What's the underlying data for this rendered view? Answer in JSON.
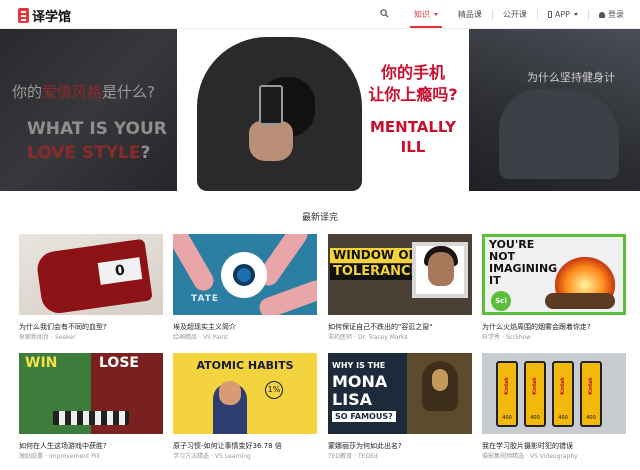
{
  "header": {
    "logo_text": "译学馆",
    "nav": [
      {
        "label": "知识",
        "active": true,
        "dropdown": true
      },
      {
        "label": "精品课",
        "active": false
      },
      {
        "label": "公开课",
        "active": false
      },
      {
        "label": "APP",
        "active": false,
        "dropdown": true
      },
      {
        "label": "登录",
        "active": false
      }
    ]
  },
  "banner": {
    "left_q_prefix": "你的",
    "left_q_hidden": "爱情风格",
    "left_q_suffix": "是什么?",
    "left_en_line1": "WHAT IS YOUR",
    "left_en_red": "LOVE STYLE",
    "left_en_end": "?",
    "center_cn_line1": "你的手机",
    "center_cn_line2": "让你上瘾吗?",
    "center_en_line1": "MENTALLY",
    "center_en_line2": "ILL",
    "right_q": "为什么坚持健身计"
  },
  "section": {
    "title": "最新译完"
  },
  "cards": [
    {
      "title": "为什么我们会有不同的血型?",
      "channel": "探索新闻台",
      "author": "Seeker",
      "thumb_text": "0"
    },
    {
      "title": "埃及超现实主义简介",
      "channel": "绘画精品",
      "author": "VS Paint",
      "thumb_text": "TATE"
    },
    {
      "title": "如何保证自己不跌出的\"容忍之窗\"",
      "channel": "零药医师",
      "author": "Dr. Tracey Marks",
      "thumb_text_1": "WINDOW OF",
      "thumb_text_2": "TOLERANCE"
    },
    {
      "title": "为什么火焰周围的烟雾会跟着你走?",
      "channel": "科学秀",
      "author": "SciShow",
      "thumb_text": "YOU'RE NOT IMAGINING IT",
      "thumb_logo": "Sci"
    },
    {
      "title": "如何在人生这场游戏中获胜?",
      "channel": "激励胶囊",
      "author": "Improvement Pill",
      "thumb_text_1": "WIN",
      "thumb_text_2": "LOSE"
    },
    {
      "title": "原子习惯-如何让事情变好36.78 倍",
      "channel": "学习方法精选",
      "author": "VS Learning",
      "thumb_text": "ATOMIC HABITS",
      "thumb_badge": "1%"
    },
    {
      "title": "蒙娜丽莎为何如此出名?",
      "channel": "TED教育",
      "author": "TEDEd",
      "thumb_text_1": "WHY IS THE",
      "thumb_text_2": "MONA LISA",
      "thumb_text_3": "SO FAMOUS?"
    },
    {
      "title": "我在学习胶片摄影时犯的错误",
      "channel": "摄影集视频精选",
      "author": "VS Videography",
      "thumb_brand": "Kodak",
      "thumb_num": "400"
    }
  ]
}
